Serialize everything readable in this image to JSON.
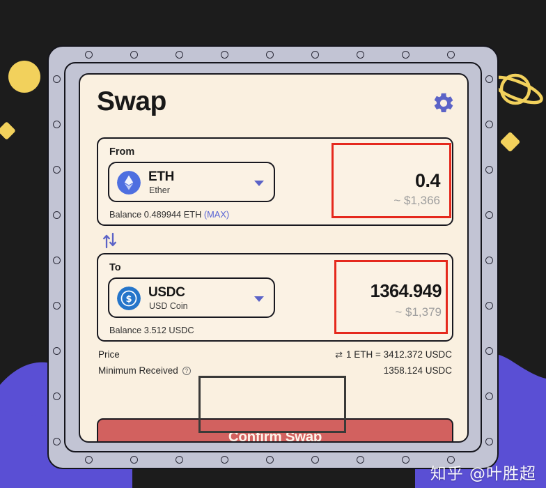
{
  "app": {
    "title": "Swap",
    "watermark": "知乎 @叶胜超"
  },
  "header": {
    "title": "Swap",
    "settings_icon": "gear-icon"
  },
  "from": {
    "label": "From",
    "token": {
      "symbol": "ETH",
      "name": "Ether",
      "logo_color": "#4e6fe0"
    },
    "balance_text": "Balance 0.489944 ETH ",
    "max_label": "(MAX)",
    "amount": "0.4",
    "amount_usd": "~ $1,366",
    "chevron_icon": "chevron-down-icon"
  },
  "swap_direction": {
    "icon": "swap-vertical-arrows-icon"
  },
  "to": {
    "label": "To",
    "token": {
      "symbol": "USDC",
      "name": "USD Coin",
      "logo_color": "#2575ca"
    },
    "balance_text": "Balance 3.512 USDC",
    "amount": "1364.949",
    "amount_usd": "~ $1,379",
    "chevron_icon": "chevron-down-icon"
  },
  "details": {
    "price_label": "Price",
    "price_value": "1 ETH = 3412.372 USDC",
    "price_swap_icon": "rate-toggle-icon",
    "minimum_received_label": "Minimum Received",
    "minimum_received_help_icon": "question-mark-icon",
    "minimum_received_value": "1358.124 USDC"
  },
  "actions": {
    "confirm_label": "Confirm Swap"
  },
  "colors": {
    "card_bg": "#faf0e0",
    "frame_bg": "#c2c4d4",
    "page_bg": "#1c1c1c",
    "accent_purple": "#5763d4",
    "wave_purple": "#5a4fd4",
    "confirm_red": "#d2615f",
    "highlight_red": "#e5291d",
    "decor_yellow": "#f2d15c"
  }
}
